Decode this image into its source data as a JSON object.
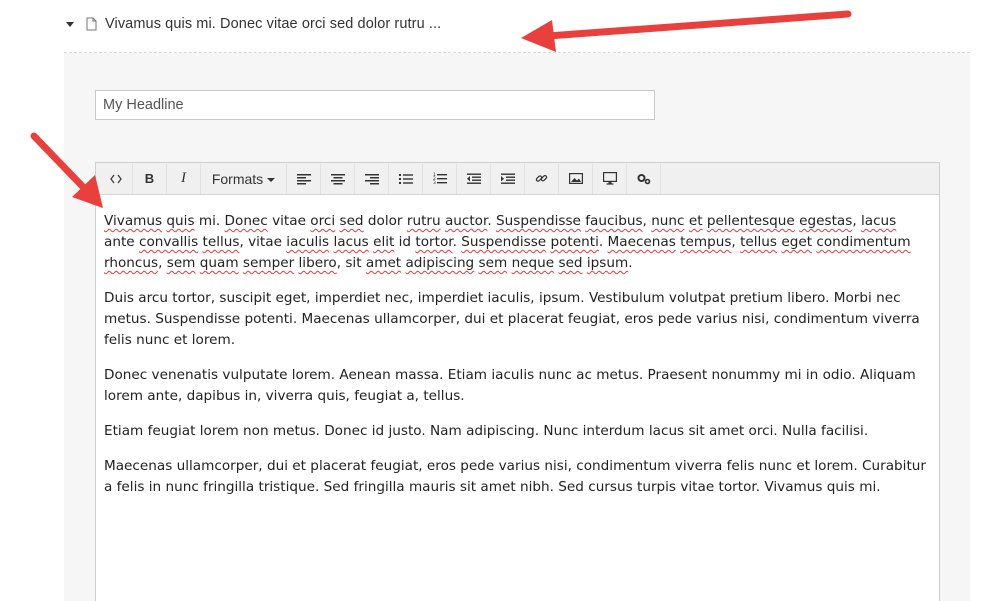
{
  "tree": {
    "title": "Vivamus quis mi. Donec vitae orci sed dolor rutru ..."
  },
  "headline": {
    "value": "My Headline"
  },
  "toolbar": {
    "source_code": "source-code-icon",
    "bold_label": "B",
    "italic_label": "I",
    "formats_label": "Formats"
  },
  "content": {
    "paragraphs": [
      "Vivamus quis mi. Donec vitae orci sed dolor rutru auctor. Suspendisse faucibus, nunc et pellentesque egestas, lacus ante convallis tellus, vitae iaculis lacus elit id tortor. Suspendisse potenti. Maecenas tempus, tellus eget condimentum rhoncus, sem quam semper libero, sit amet adipiscing sem neque sed ipsum.",
      "Duis arcu tortor, suscipit eget, imperdiet nec, imperdiet iaculis, ipsum. Vestibulum volutpat pretium libero. Morbi nec metus. Suspendisse potenti. Maecenas ullamcorper, dui et placerat feugiat, eros pede varius nisi, condimentum viverra felis nunc et lorem.",
      "Donec venenatis vulputate lorem. Aenean massa. Etiam iaculis nunc ac metus. Praesent nonummy mi in odio. Aliquam lorem ante, dapibus in, viverra quis, feugiat a, tellus.",
      "Etiam feugiat lorem non metus. Donec id justo. Nam adipiscing. Nunc interdum lacus sit amet orci. Nulla facilisi.",
      "Maecenas ullamcorper, dui et placerat feugiat, eros pede varius nisi, condimentum viverra felis nunc et lorem. Curabitur a felis in nunc fringilla tristique. Sed fringilla mauris sit amet nibh. Sed cursus turpis vitae tortor. Vivamus quis mi."
    ]
  },
  "colors": {
    "arrow": "#e8403d",
    "panel": "#f6f6f6",
    "spell_underline": "#e0393e"
  }
}
